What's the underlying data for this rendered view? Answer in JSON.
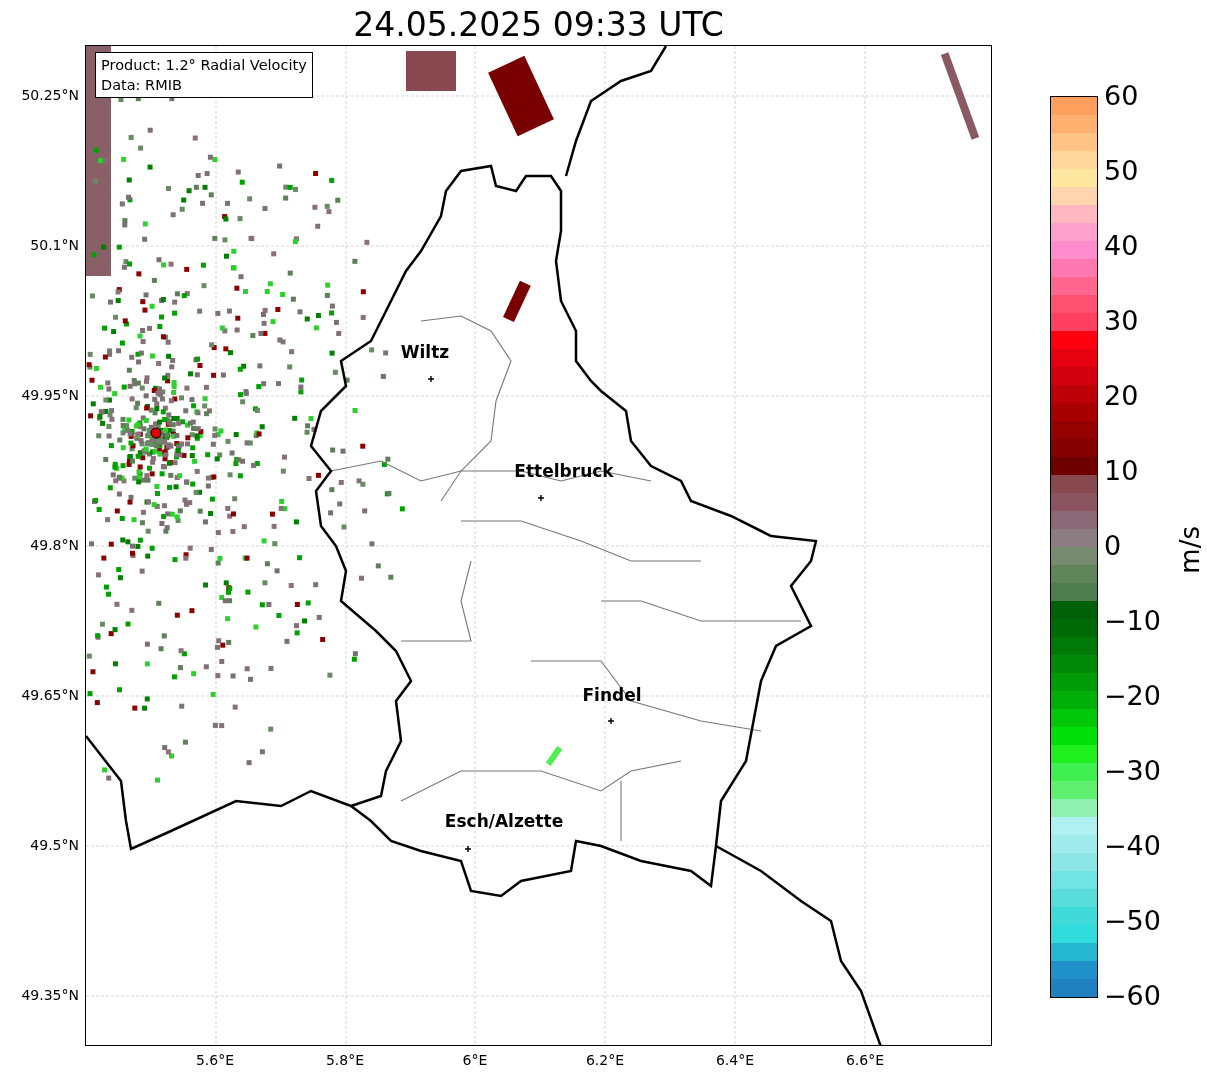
{
  "title": "24.05.2025 09:33 UTC",
  "legend": {
    "product": "Product: 1.2° Radial Velocity",
    "data": "Data: RMIB"
  },
  "y_ticks": [
    "50.25°N",
    "50.1°N",
    "49.95°N",
    "49.8°N",
    "49.65°N",
    "49.5°N",
    "49.35°N"
  ],
  "x_ticks": [
    "5.6°E",
    "5.8°E",
    "6°E",
    "6.2°E",
    "6.4°E",
    "6.6°E"
  ],
  "cities": [
    {
      "name": "Wiltz"
    },
    {
      "name": "Ettelbruck"
    },
    {
      "name": "Findel"
    },
    {
      "name": "Esch/Alzette"
    }
  ],
  "colorbar": {
    "label": "m/s",
    "ticks": [
      "60",
      "50",
      "40",
      "30",
      "20",
      "10",
      "0",
      "−10",
      "−20",
      "−30",
      "−40",
      "−50",
      "−60"
    ]
  }
}
